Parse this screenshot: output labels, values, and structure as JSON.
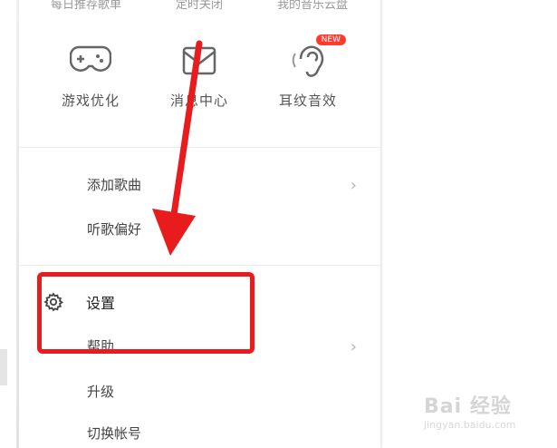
{
  "top_row": [
    "每日推荐歌单",
    "定时关闭",
    "我的音乐云盘"
  ],
  "grid": [
    {
      "icon": "gamepad-icon",
      "label": "游戏优化"
    },
    {
      "icon": "mail-icon",
      "label": "消息中心"
    },
    {
      "icon": "ear-icon",
      "label": "耳纹音效",
      "badge": "NEW"
    }
  ],
  "menu_a": [
    {
      "label": "添加歌曲",
      "chevron": "›"
    },
    {
      "label": "听歌偏好"
    }
  ],
  "menu_b": [
    {
      "label": "设置",
      "icon": "gear-icon"
    },
    {
      "label": "帮助",
      "chevron": "›"
    },
    {
      "label": "升级"
    },
    {
      "label": "切换帐号"
    }
  ],
  "watermark": {
    "brand": "Bai 经验",
    "url": "jingyan.baidu.com"
  },
  "colors": {
    "annotation": "#e81c1c",
    "badge": "#ff3b30"
  }
}
